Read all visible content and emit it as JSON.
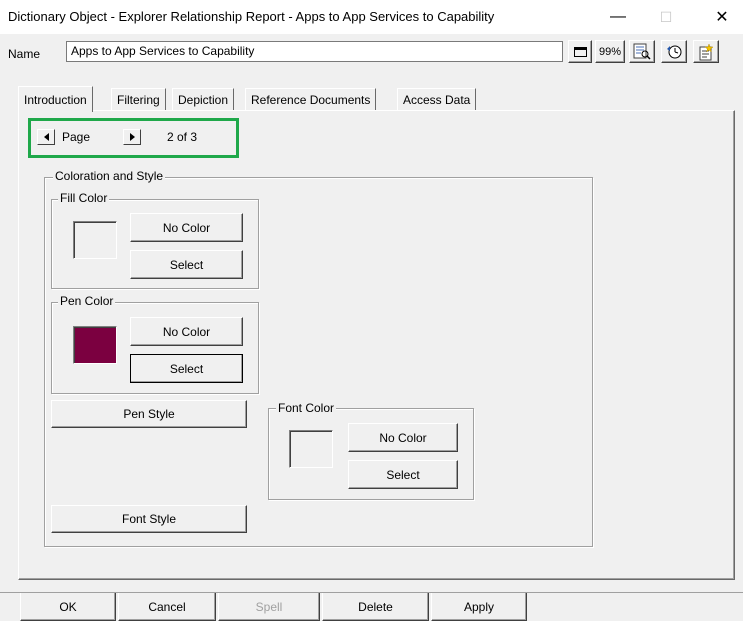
{
  "window": {
    "title": "Dictionary Object - Explorer Relationship Report - Apps to App Services to Capability",
    "minimize": "—",
    "maximize": "☐",
    "close": "✕"
  },
  "name_row": {
    "label": "Name",
    "value": "Apps to App Services to Capability",
    "zoom": "99%"
  },
  "tabs": [
    {
      "label": "Introduction"
    },
    {
      "label": "Filtering"
    },
    {
      "label": "Depiction"
    },
    {
      "label": "Reference Documents"
    },
    {
      "label": "Access Data"
    }
  ],
  "pager": {
    "label": "Page",
    "status": "2 of 3"
  },
  "coloration": {
    "title": "Coloration and Style",
    "fill": {
      "title": "Fill Color",
      "no_color": "No Color",
      "select": "Select",
      "swatch": "#f0f0f0"
    },
    "pen": {
      "title": "Pen Color",
      "no_color": "No Color",
      "select": "Select",
      "swatch": "#7b0040"
    },
    "pen_style": "Pen Style",
    "font": {
      "title": "Font Color",
      "no_color": "No Color",
      "select": "Select",
      "swatch": "#f0f0f0"
    },
    "font_style": "Font Style"
  },
  "footer": {
    "ok": "OK",
    "cancel": "Cancel",
    "spell": "Spell",
    "delete": "Delete",
    "apply": "Apply"
  },
  "colors": {
    "highlight": "#1fa84a",
    "pen_swatch": "#7b0040"
  }
}
